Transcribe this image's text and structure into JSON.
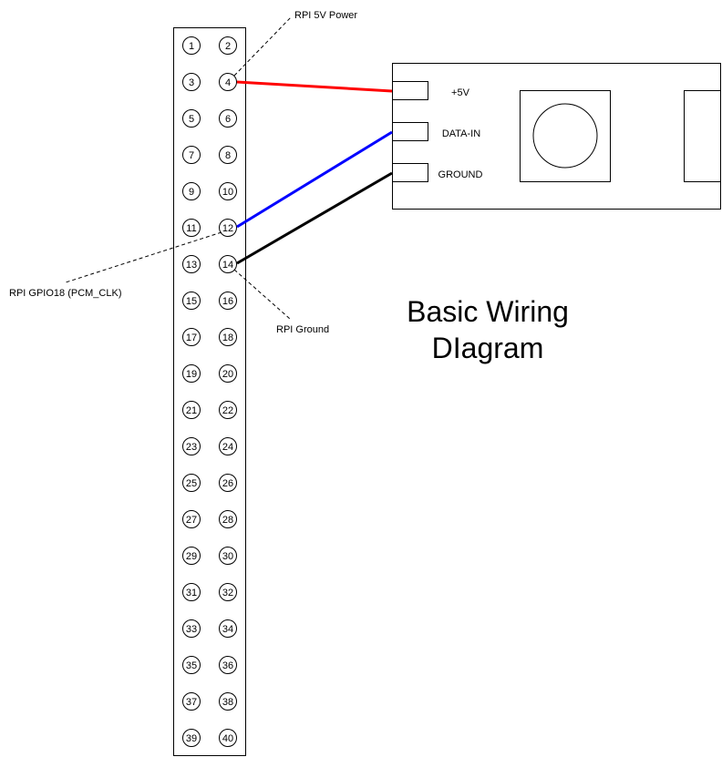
{
  "header": {
    "title_line1": "Basic Wiring",
    "title_line2": "DIagram"
  },
  "header_pins": [
    {
      "left": "1",
      "right": "2"
    },
    {
      "left": "3",
      "right": "4"
    },
    {
      "left": "5",
      "right": "6"
    },
    {
      "left": "7",
      "right": "8"
    },
    {
      "left": "9",
      "right": "10"
    },
    {
      "left": "11",
      "right": "12"
    },
    {
      "left": "13",
      "right": "14"
    },
    {
      "left": "15",
      "right": "16"
    },
    {
      "left": "17",
      "right": "18"
    },
    {
      "left": "19",
      "right": "20"
    },
    {
      "left": "21",
      "right": "22"
    },
    {
      "left": "23",
      "right": "24"
    },
    {
      "left": "25",
      "right": "26"
    },
    {
      "left": "27",
      "right": "28"
    },
    {
      "left": "29",
      "right": "30"
    },
    {
      "left": "31",
      "right": "32"
    },
    {
      "left": "33",
      "right": "34"
    },
    {
      "left": "35",
      "right": "36"
    },
    {
      "left": "37",
      "right": "38"
    },
    {
      "left": "39",
      "right": "40"
    }
  ],
  "pin_labels": {
    "power": "RPI 5V Power",
    "gpio": "RPI GPIO18 (PCM_CLK)",
    "ground": "RPI Ground"
  },
  "led_terminals": {
    "power": "+5V",
    "data": "DATA-IN",
    "ground": "GROUND"
  },
  "wire_colors": {
    "power": "#ff0000",
    "data": "#0000ff",
    "ground": "#000000"
  }
}
